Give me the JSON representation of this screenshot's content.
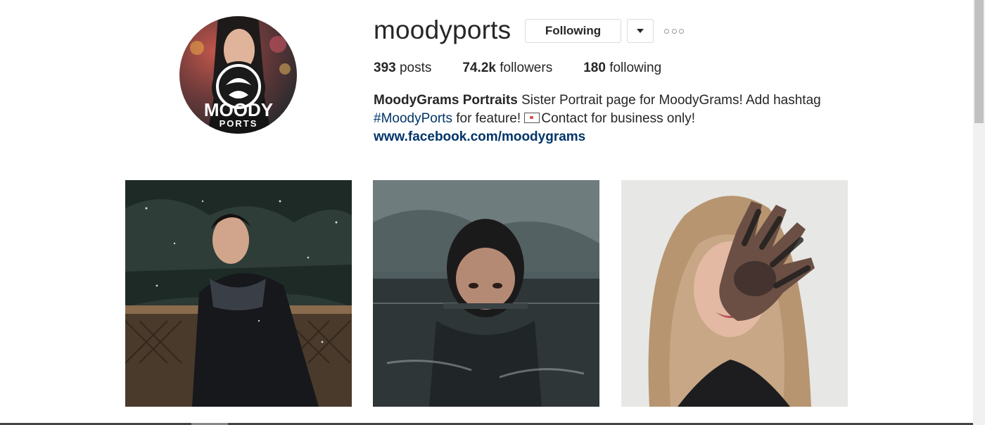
{
  "profile": {
    "username": "moodyports",
    "follow_label": "Following",
    "dropdown_icon": "caret-down-icon",
    "options_icon": "more-options-icon",
    "avatar_text_line1": "MOODY",
    "avatar_text_line2": "PORTS"
  },
  "stats": {
    "posts_count": "393",
    "posts_label": "posts",
    "followers_count": "74.2k",
    "followers_label": "followers",
    "following_count": "180",
    "following_label": "following"
  },
  "bio": {
    "full_name": "MoodyGrams Portraits",
    "text_1": " Sister Portrait page for MoodyGrams! Add hashtag ",
    "hashtag": "#MoodyPorts",
    "text_2": " for feature! ",
    "text_3": "Contact for business only!",
    "website": "www.facebook.com/moodygrams",
    "envelope_icon": "envelope-icon"
  },
  "colors": {
    "link": "#003569",
    "text": "#262626",
    "border": "#dbdbdb"
  }
}
